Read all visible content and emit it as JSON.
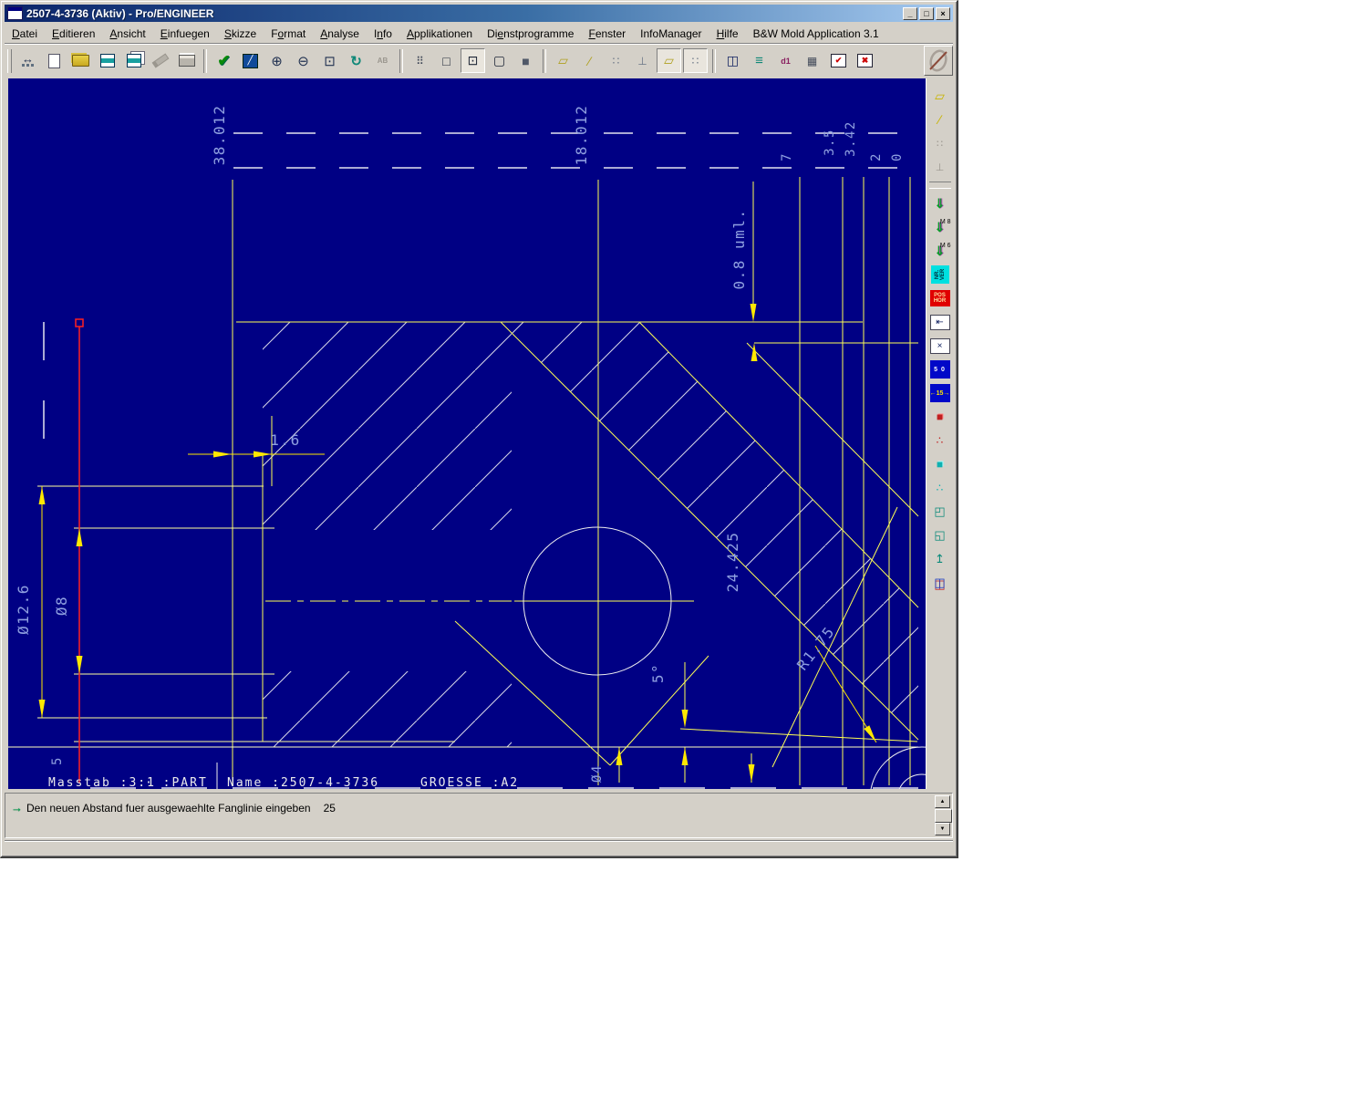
{
  "window": {
    "title": "2507-4-3736 (Aktiv) - Pro/ENGINEER",
    "controls": {
      "minimize": "_",
      "maximize": "□",
      "close": "×"
    }
  },
  "menu": {
    "items": [
      {
        "name": "menu-datei",
        "label": "Datei",
        "u": 0
      },
      {
        "name": "menu-editieren",
        "label": "Editieren",
        "u": 0
      },
      {
        "name": "menu-ansicht",
        "label": "Ansicht",
        "u": 0
      },
      {
        "name": "menu-einfuegen",
        "label": "Einfuegen",
        "u": 0
      },
      {
        "name": "menu-skizze",
        "label": "Skizze",
        "u": 0
      },
      {
        "name": "menu-format",
        "label": "Format",
        "u": 1
      },
      {
        "name": "menu-analyse",
        "label": "Analyse",
        "u": 0
      },
      {
        "name": "menu-info",
        "label": "Info",
        "u": 1
      },
      {
        "name": "menu-applikationen",
        "label": "Applikationen",
        "u": 0
      },
      {
        "name": "menu-dienstprogramme",
        "label": "Dienstprogramme",
        "u": 2
      },
      {
        "name": "menu-fenster",
        "label": "Fenster",
        "u": 0
      },
      {
        "name": "menu-infomanager",
        "label": "InfoManager",
        "u": -1
      },
      {
        "name": "menu-hilfe",
        "label": "Hilfe",
        "u": 0
      },
      {
        "name": "menu-bw-mold-application",
        "label": "B&W Mold Application 3.1",
        "u": -1
      }
    ]
  },
  "toolbar": {
    "items": [
      {
        "handle": true
      },
      {
        "name": "dimension-tool-icon",
        "g": "↔",
        "gc": "c-dim"
      },
      {
        "name": "new-file-icon",
        "g": "",
        "gc": "g-new"
      },
      {
        "name": "open-file-icon",
        "g": "",
        "gc": "g-open"
      },
      {
        "name": "save-icon",
        "g": "",
        "gc": "g-save"
      },
      {
        "name": "save-as-icon",
        "g": "",
        "gc": "g-saveas"
      },
      {
        "name": "highlighter-icon",
        "g": "",
        "gc": "g-marker",
        "disabled": true
      },
      {
        "name": "print-icon",
        "g": "",
        "gc": "g-print"
      },
      {
        "sep": true
      },
      {
        "name": "accept-check-icon",
        "g": "✔",
        "gc": "c-green"
      },
      {
        "name": "sketch-view-icon",
        "g": "╱",
        "gc": "g-sketch"
      },
      {
        "name": "zoom-in-icon",
        "g": "⊕",
        "gc": "c-zoom"
      },
      {
        "name": "zoom-out-icon",
        "g": "⊖",
        "gc": "c-zoom"
      },
      {
        "name": "zoom-fit-icon",
        "g": "⊡",
        "gc": "c-zoom"
      },
      {
        "name": "reorient-view-icon",
        "g": "↻",
        "gc": "c-layers"
      },
      {
        "name": "text-style-icon",
        "g": "AB",
        "gc": "c-ab",
        "disabled": true
      },
      {
        "sep": true
      },
      {
        "name": "model-tree-icon",
        "g": "⠿",
        "gc": "c-tree"
      },
      {
        "name": "wireframe-icon",
        "g": "□",
        "gc": "c-cube"
      },
      {
        "name": "hidden-line-icon",
        "g": "⊡",
        "gc": "c-cube",
        "pressed": true
      },
      {
        "name": "no-hidden-icon",
        "g": "▢",
        "gc": "c-cube"
      },
      {
        "name": "shaded-icon",
        "g": "■",
        "gc": "c-shade"
      },
      {
        "sep": true
      },
      {
        "name": "datum-planes-display-icon",
        "g": "▱",
        "gc": "c-datum"
      },
      {
        "name": "datum-axes-display-icon",
        "g": "∕",
        "gc": "c-datum"
      },
      {
        "name": "datum-points-display-icon",
        "g": "∷",
        "gc": "c-datumg"
      },
      {
        "name": "csys-display-icon",
        "g": "⊥",
        "gc": "c-datumg"
      },
      {
        "name": "plane-tags-icon",
        "g": "▱",
        "gc": "c-datum",
        "pressed": true
      },
      {
        "name": "point-tags-icon",
        "g": "∷",
        "gc": "c-datumg",
        "pressed": true
      },
      {
        "sep": true
      },
      {
        "name": "new-window-icon",
        "g": "◫",
        "gc": "c-navyic"
      },
      {
        "name": "layers-icon",
        "g": "≡",
        "gc": "c-layers"
      },
      {
        "name": "dimension-properties-icon",
        "g": "d1",
        "gc": "c-d1"
      },
      {
        "name": "table-icon",
        "g": "▦",
        "gc": "c-tree"
      },
      {
        "name": "window-activate-icon",
        "g": "✔",
        "gc": "g-winbox"
      },
      {
        "name": "window-close-icon",
        "g": "✖",
        "gc": "g-winbox"
      }
    ]
  },
  "sidebar": {
    "items": [
      {
        "name": "datum-plane-icon",
        "g": "▱",
        "gc": "s-yellow"
      },
      {
        "name": "datum-axis-icon",
        "g": "∕",
        "gc": "s-yellow"
      },
      {
        "name": "datum-point-icon",
        "g": "∷",
        "gc": "s-disabled",
        "disabled": true
      },
      {
        "name": "csys-icon",
        "g": "⊥",
        "gc": "s-disabled",
        "disabled": true
      },
      {
        "sep": true
      },
      {
        "name": "hole-tool-icon",
        "g": "⇓",
        "gc": "s-drill"
      },
      {
        "name": "hole-m8-icon",
        "g": "⇓",
        "gc": "s-drill",
        "lab": "M 8"
      },
      {
        "name": "hole-m6-icon",
        "g": "⇓",
        "gc": "s-drill",
        "lab": "M 6"
      },
      {
        "name": "nr-ver-button",
        "g": "NR. VER",
        "gc": "s-cyanbox"
      },
      {
        "name": "pos-hor-button",
        "g": "POS HOR",
        "gc": "s-redbox"
      },
      {
        "name": "undo-selection-icon",
        "g": "⇤",
        "gc": "s-whitebox"
      },
      {
        "name": "delete-selection-icon",
        "g": "×",
        "gc": "s-whitebox"
      },
      {
        "name": "dim-5-0-button",
        "g": "5 0",
        "gc": "s-bluebox"
      },
      {
        "name": "dim-15-button",
        "g": "←15→",
        "gc": "s-bluebox y"
      },
      {
        "name": "red-block-icon",
        "g": "■",
        "gc": "s-redcube"
      },
      {
        "name": "red-pattern-icon",
        "g": "∴",
        "gc": "s-redpat"
      },
      {
        "name": "cyan-block-icon",
        "g": "■",
        "gc": "s-cyancube"
      },
      {
        "name": "cyan-pattern-icon",
        "g": "∴",
        "gc": "s-cyanpat"
      },
      {
        "name": "round-tool-icon",
        "g": "◰",
        "gc": "s-teal"
      },
      {
        "name": "chamfer-tool-icon",
        "g": "◱",
        "gc": "s-teal"
      },
      {
        "name": "eject-tool-icon",
        "g": "↥",
        "gc": "s-teal"
      },
      {
        "name": "mirror-section-icon",
        "g": "◫",
        "gc": "s-mirror"
      }
    ]
  },
  "drawing": {
    "dims": {
      "k38": "38.012",
      "k18": "18.012",
      "k7": "7",
      "k35": "3.5",
      "k342": "3.42",
      "k2": "2",
      "k0": "0",
      "k08": "0.8 uml.",
      "k16": "1.6",
      "k126": "Ø12.6",
      "k8": "Ø8",
      "k24": "24.425",
      "k5deg": "5°",
      "kR175": "R1.75",
      "k5": "5",
      "k4": "Ø4"
    },
    "titleblock": {
      "scale": "Masstab :3:1",
      "part": "· :PART",
      "name": "Name :2507-4-3736",
      "size": "GROESSE :A2"
    }
  },
  "statusbar": {
    "prompt_icon": "→",
    "message": "Den neuen Abstand fuer ausgewaehlte Fanglinie eingeben",
    "value": "25"
  },
  "colors": {
    "canvas_bg": "#000084",
    "geometry_yellow": "#ffff54",
    "geometry_pale": "#ffff9c",
    "dimension_text": "#8fa0e0",
    "highlight_red": "#ff2020",
    "hatch_white": "#d8d8e8"
  }
}
